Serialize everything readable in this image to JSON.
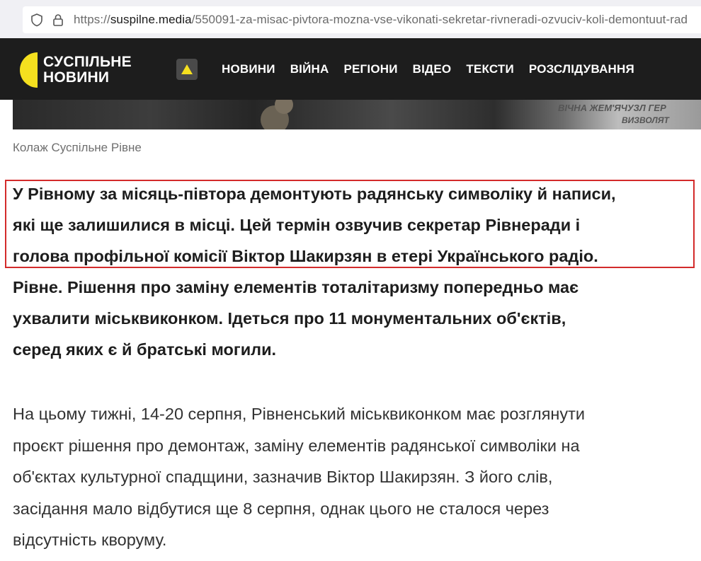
{
  "browser": {
    "url_prefix": "https://",
    "url_host": "suspilne.media",
    "url_path": "/550091-za-misac-pivtora-mozna-vse-vikonati-sekretar-rivneradi-ozvuciv-koli-demontuut-rad",
    "icons": [
      "shield-icon",
      "lock-icon"
    ]
  },
  "header": {
    "logo_line1": "СУСПІЛЬНЕ",
    "logo_line2": "НОВИНИ",
    "nav": [
      "НОВИНИ",
      "ВІЙНА",
      "РЕГІОНИ",
      "ВІДЕО",
      "ТЕКСТИ",
      "РОЗСЛІДУВАННЯ"
    ],
    "accent_color": "#f5e01f",
    "background_color": "#1d1d1d"
  },
  "image": {
    "stone_text1": "ВІЧНА ЖЕМ'ЯЧУЗЛ ГЕР",
    "stone_text2": "ВИЗВОЛЯТ"
  },
  "article": {
    "caption": "Колаж Суспільне Рівне",
    "lead_lines": [
      "У Рівному за місяць-півтора демонтують радянську символіку й написи,",
      "які ще залишилися в місці. Цей термін озвучив секретар Рівнеради і",
      "голова профільної комісії Віктор Шакирзян в етері Українського радіо.",
      "Рівне. Рішення про заміну елементів тоталітаризму попередньо має",
      "ухвалити міськвиконком. Ідеться про 11 монументальних об'єктів,",
      "серед яких є й братські могили."
    ],
    "body_lines": [
      "На цьому тижні, 14-20 серпня, Рівненський міськвиконком має розглянути",
      "проєкт рішення про демонтаж, заміну елементів радянської символіки на",
      "об'єктах культурної спадщини, зазначив Віктор Шакирзян. З його слів,",
      "засідання мало відбутися ще 8 серпня, однак цього не сталося через",
      "відсутність кворуму."
    ],
    "highlight_color": "#d32b2b"
  }
}
